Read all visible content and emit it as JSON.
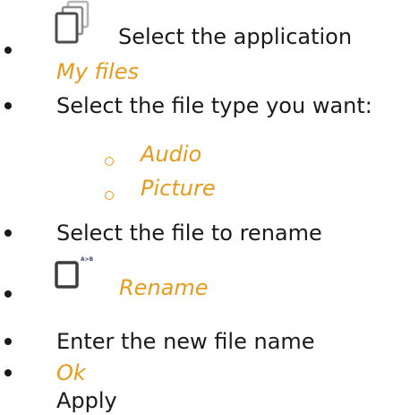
{
  "colors": {
    "text": "#1a1a1a",
    "accent": "#e89a1c"
  },
  "steps": [
    {
      "icon": "app-stack-icon",
      "text": "Select the application",
      "sub_text": "My files"
    },
    {
      "text": "Select the file type you want:"
    },
    {
      "text": "Select the file to rename"
    },
    {
      "icon": "rename-file-icon",
      "icon_label": "A>B",
      "text": "Rename"
    },
    {
      "text": "Enter the new file name"
    },
    {
      "text": "Ok",
      "sub_text": "Apply"
    }
  ],
  "file_types": [
    "Audio",
    "Picture"
  ]
}
